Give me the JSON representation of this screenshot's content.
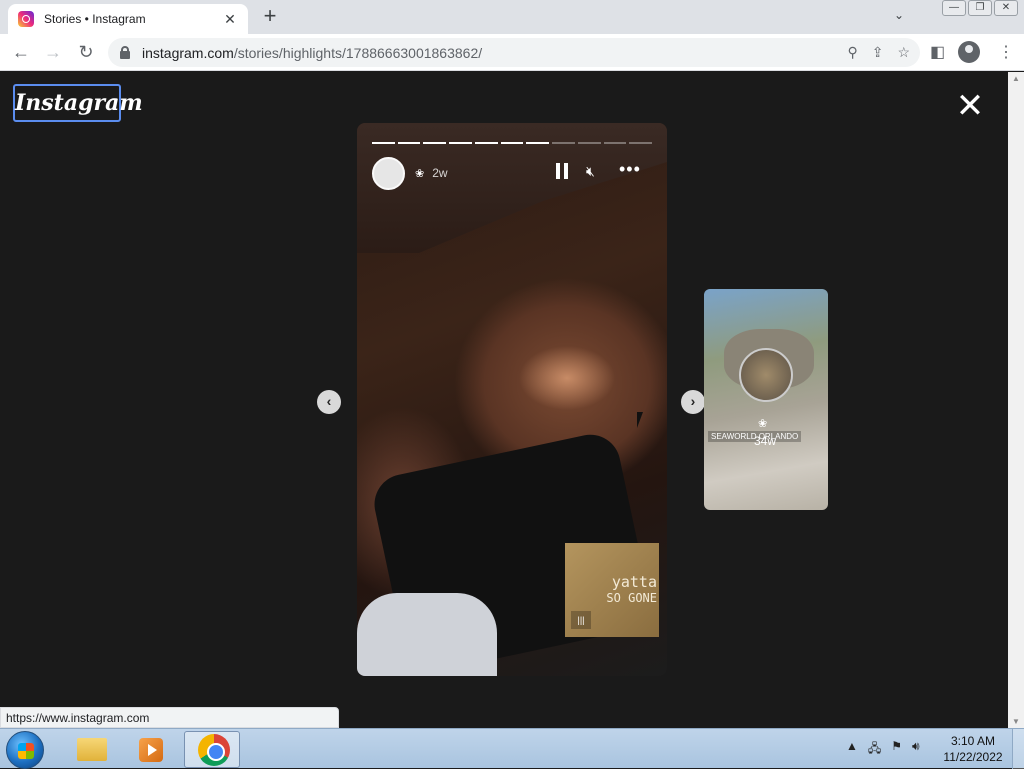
{
  "browser": {
    "tab_title": "Stories • Instagram",
    "tab_close": "✕",
    "new_tab": "+",
    "url_host": "instagram.com",
    "url_path": "/stories/highlights/17886663001863862/",
    "status_url": "https://www.instagram.com"
  },
  "page": {
    "logo": "Instagram",
    "close": "✕",
    "story": {
      "time": "2w",
      "progress_total": 11,
      "progress_done": 7
    },
    "music": {
      "line1": "yatta",
      "line2": "SO GONE"
    },
    "next_story": {
      "location": "SEAWORLD ORLANDO",
      "age": "34w"
    }
  },
  "taskbar": {
    "time": "3:10 AM",
    "date": "11/22/2022"
  },
  "colors": {
    "page_bg": "#1a1a1a",
    "taskbar": "#bfd4ea"
  }
}
